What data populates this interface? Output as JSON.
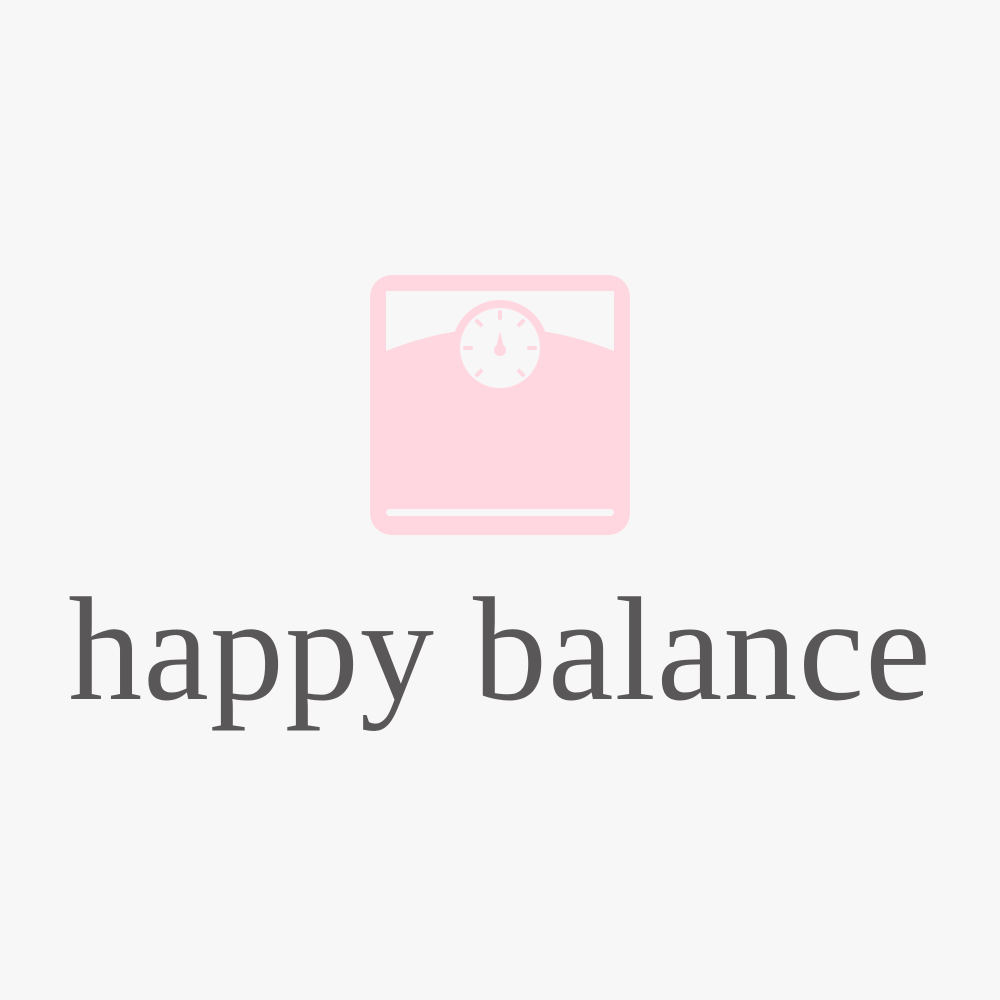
{
  "brand": {
    "name": "happy balance",
    "icon": "bathroom-scale-icon"
  },
  "colors": {
    "background": "#f7f7f7",
    "icon_fill": "#ffd7e0",
    "icon_light": "#f7f7f7",
    "text": "#595757"
  }
}
